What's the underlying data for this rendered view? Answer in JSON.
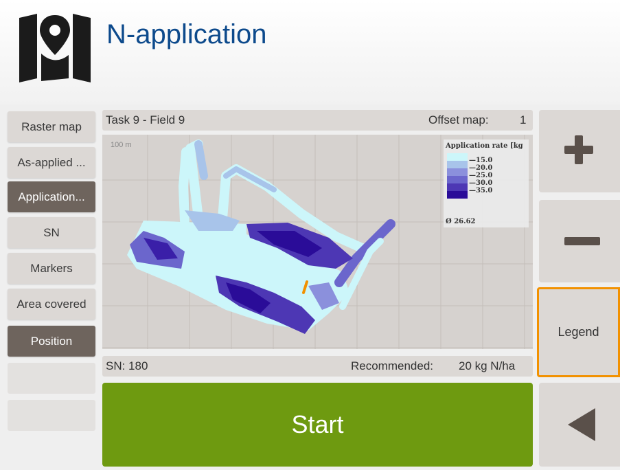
{
  "header": {
    "title": "N-application",
    "icon": "map-pin-icon"
  },
  "sidebar": {
    "items": [
      {
        "label": "Raster map",
        "state": "normal"
      },
      {
        "label": "As-applied ...",
        "state": "normal"
      },
      {
        "label": "Application...",
        "state": "selected"
      },
      {
        "label": "SN",
        "state": "normal"
      },
      {
        "label": "Markers",
        "state": "normal"
      },
      {
        "label": "Area covered",
        "state": "normal"
      },
      {
        "label": "Position",
        "state": "selected"
      },
      {
        "label": "",
        "state": "empty"
      },
      {
        "label": "",
        "state": "empty"
      }
    ]
  },
  "top_bar": {
    "task": "Task 9 - Field 9",
    "offset_label": "Offset map:",
    "offset_value": "1"
  },
  "map": {
    "scale_label": "100 m",
    "legend": {
      "title": "Application rate [kg",
      "entries": [
        {
          "label": "15.0",
          "color": "#ccf6fa"
        },
        {
          "label": "20.0",
          "color": "#a8c4ea"
        },
        {
          "label": "25.0",
          "color": "#8b90dc"
        },
        {
          "label": "30.0",
          "color": "#6b66cc"
        },
        {
          "label": "35.0",
          "color": "#4d37b4"
        },
        {
          "label": "",
          "color": "#2a0c98"
        }
      ],
      "mean": "Ø 26.62"
    }
  },
  "bottom_bar": {
    "sn": "SN: 180",
    "recommended_label": "Recommended:",
    "recommended_value": "20 kg N/ha"
  },
  "start_button": {
    "label": "Start"
  },
  "right_panel": {
    "zoom_in_icon": "plus-icon",
    "zoom_out_icon": "minus-icon",
    "legend_label": "Legend",
    "back_icon": "back-arrow-icon"
  },
  "colors": {
    "title": "#0d4a8c",
    "button_selected": "#6e645d",
    "button_normal": "#dcd8d5",
    "start": "#6e9a10",
    "highlight": "#f29100",
    "field_light": "#ccf6fa",
    "field_dark": "#3a1fa8"
  }
}
